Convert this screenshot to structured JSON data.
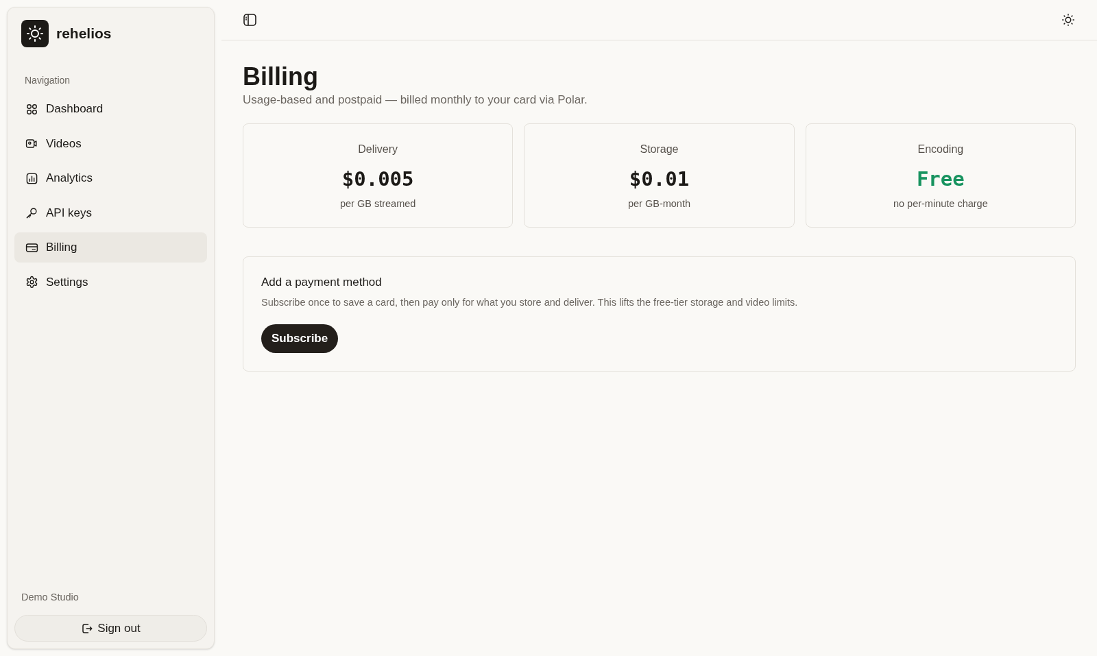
{
  "sidebar": {
    "brand": "rehelios",
    "section_label": "Navigation",
    "items": [
      {
        "label": "Dashboard",
        "selected": false
      },
      {
        "label": "Videos",
        "selected": false
      },
      {
        "label": "Analytics",
        "selected": false
      },
      {
        "label": "API keys",
        "selected": false
      },
      {
        "label": "Billing",
        "selected": true
      },
      {
        "label": "Settings",
        "selected": false
      }
    ],
    "account": "Demo Studio",
    "sign_out": "Sign out"
  },
  "header": {
    "title": "Billing",
    "subtitle": "Usage-based and postpaid — billed monthly to your card via Polar."
  },
  "price_cards": [
    {
      "label": "Delivery",
      "price": "$0.005",
      "unit": "per GB streamed",
      "kind": "paid"
    },
    {
      "label": "Storage",
      "price": "$0.01",
      "unit": "per GB-month",
      "kind": "paid"
    },
    {
      "label": "Encoding",
      "price": "Free",
      "unit": "no per-minute charge",
      "kind": "free"
    }
  ],
  "payment": {
    "title": "Add a payment method",
    "description": "Subscribe once to save a card, then pay only for what you store and deliver. This lifts the free-tier storage and video limits.",
    "button": "Subscribe"
  }
}
